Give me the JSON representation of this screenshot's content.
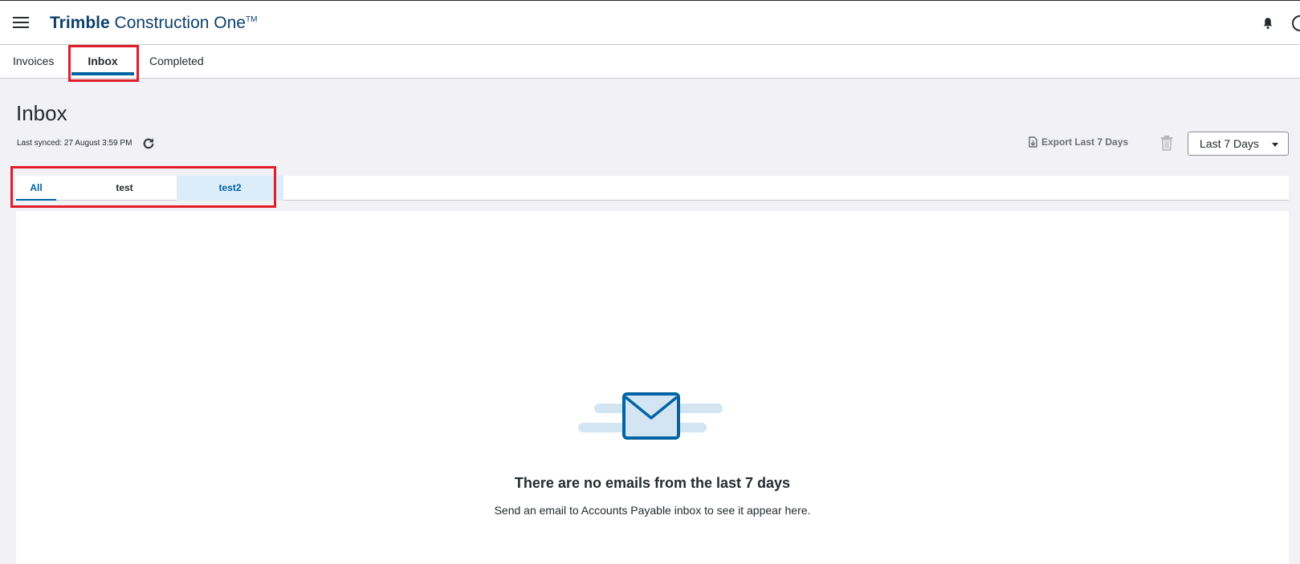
{
  "header": {
    "brand_strong": "Trimble",
    "brand_light": " Construction One",
    "brand_tm": "TM"
  },
  "nav": {
    "tabs": [
      {
        "label": "Invoices"
      },
      {
        "label": "Inbox",
        "active": true
      },
      {
        "label": "Completed"
      }
    ]
  },
  "page": {
    "title": "Inbox",
    "last_synced": "Last synced: 27 August 3:59 PM",
    "export_label": "Export Last 7 Days",
    "date_range_selected": "Last 7 Days"
  },
  "subtabs": [
    {
      "label": "All",
      "active": true
    },
    {
      "label": "test"
    },
    {
      "label": "test2",
      "highlighted": true
    }
  ],
  "empty_state": {
    "title": "There are no emails from the last 7 days",
    "subtitle": "Send an email to Accounts Payable inbox to see it appear here."
  },
  "colors": {
    "brand": "#0e416c",
    "accent": "#0063a3",
    "highlight_box": "#e11d2a",
    "subtab_selected_bg": "#dcedf9"
  },
  "icons": [
    "menu-icon",
    "bell-icon",
    "user-icon",
    "refresh-icon",
    "export-icon",
    "trash-icon",
    "caret-down-icon",
    "envelope-icon"
  ]
}
